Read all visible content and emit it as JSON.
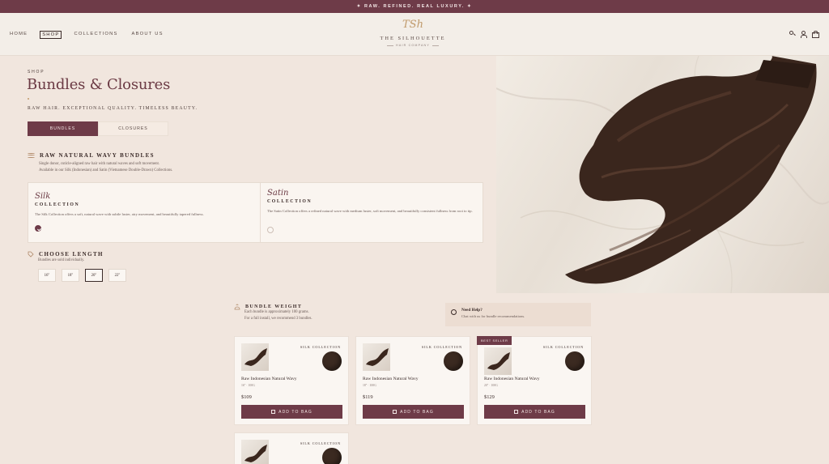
{
  "announcement": "✦ RAW. REFINED. REAL LUXURY. ✦",
  "nav": [
    "HOME",
    "SHOP",
    "COLLECTIONS",
    "ABOUT US"
  ],
  "logo": {
    "mark": "TSh",
    "title": "THE SILHOUETTE",
    "subtitle": "HAIR COMPANY"
  },
  "hero": {
    "eyebrow": "SHOP",
    "title": "Bundles & Closures",
    "tagline": "RAW HAIR. EXCEPTIONAL QUALITY. TIMELESS BEAUTY."
  },
  "tabs": [
    "BUNDLES",
    "CLOSURES"
  ],
  "section_wavy": {
    "title": "RAW NATURAL WAVY BUNDLES",
    "line1": "Single donor, cuticle-aligned raw hair with natural waves and soft movement.",
    "line2": "Available in our Silk (Indonesian) and Satin (Vietnamese Double-Drawn) Collections."
  },
  "collections": [
    {
      "script": "Silk",
      "label": "COLLECTION",
      "desc": "The Silk Collection offers a soft, natural wave with subtle luster, airy movement, and beautifully tapered fullness."
    },
    {
      "script": "Satin",
      "label": "COLLECTION",
      "desc": "The Satin Collection offers a refined natural wave with medium luster, soft movement, and beautifully consistent fullness from root to tip."
    }
  ],
  "length": {
    "title": "CHOOSE LENGTH",
    "sub": "Bundles are sold individually.",
    "options": [
      "16\"",
      "18\"",
      "20\"",
      "22\""
    ]
  },
  "weight": {
    "title": "BUNDLE WEIGHT",
    "line1": "Each bundle is approximately 100 grams.",
    "line2": "For a full install, we recommend 3 bundles."
  },
  "help": {
    "title": "Need Help?",
    "sub": "Chat with us for bundle recommendations."
  },
  "products": [
    {
      "collection": "SILK COLLECTION",
      "name": "Raw Indonesian Natural Wavy",
      "meta": "16\" · 100G",
      "price": "$109",
      "button": "ADD TO BAG",
      "badge": ""
    },
    {
      "collection": "SILK COLLECTION",
      "name": "Raw Indonesian Natural Wavy",
      "meta": "18\" · 100G",
      "price": "$119",
      "button": "ADD TO BAG",
      "badge": ""
    },
    {
      "collection": "SILK COLLECTION",
      "name": "Raw Indonesian Natural Wavy",
      "meta": "20\" · 100G",
      "price": "$129",
      "button": "ADD TO BAG",
      "badge": "BEST SELLER"
    },
    {
      "collection": "SILK COLLECTION",
      "name": "",
      "meta": "",
      "price": "",
      "button": "",
      "badge": ""
    }
  ],
  "colors": {
    "accent": "#6e3b48",
    "background": "#f1e6de",
    "gold": "#c09a6b",
    "hair": "#3b2a21"
  },
  "icons": [
    "search-icon",
    "account-icon",
    "bag-icon",
    "wave-icon",
    "tag-icon",
    "scale-icon",
    "chat-icon"
  ]
}
